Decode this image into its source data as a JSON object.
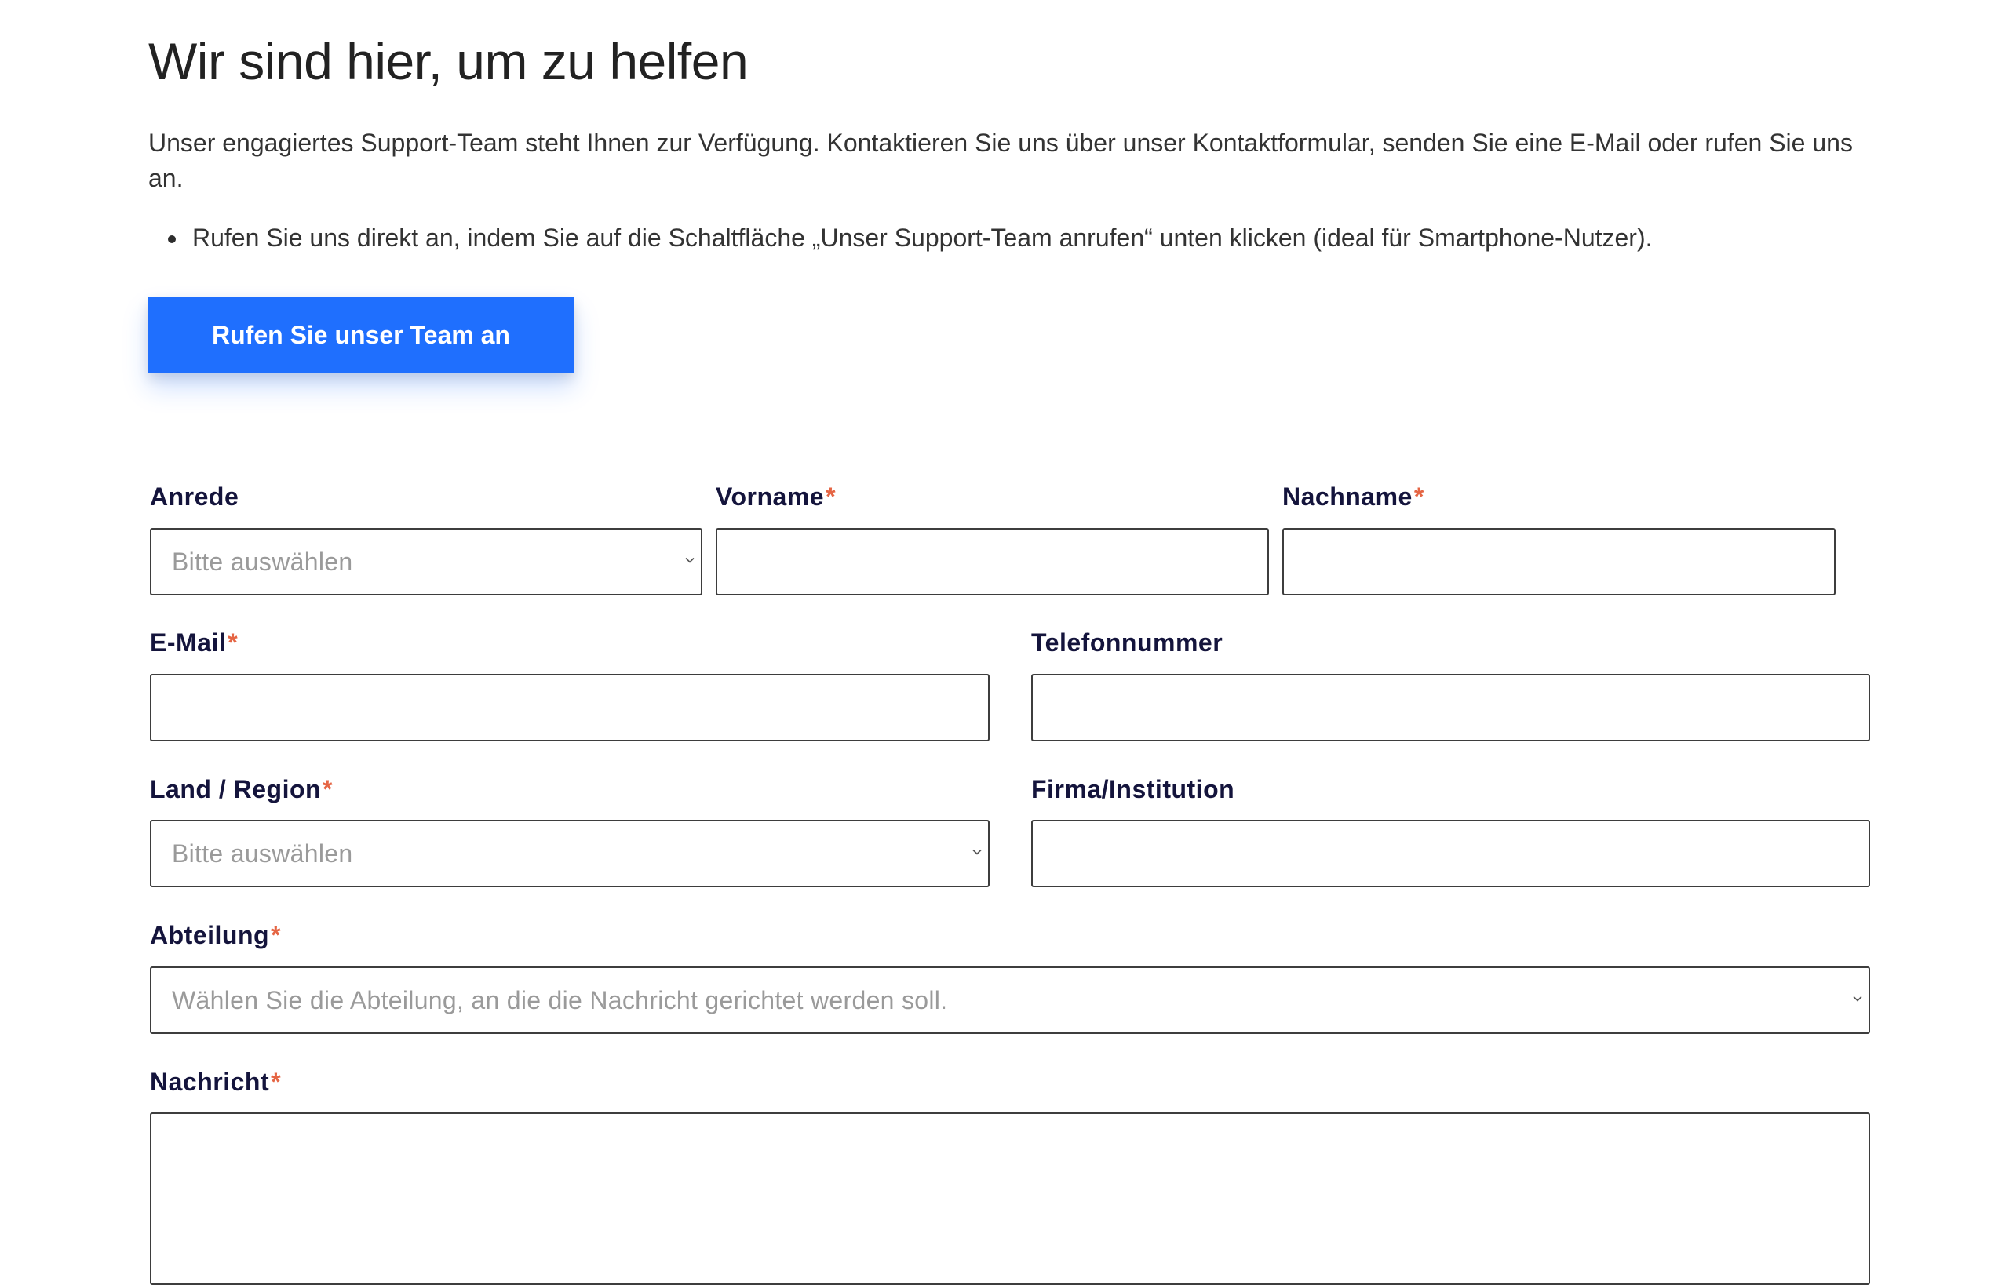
{
  "header": {
    "title": "Wir sind hier, um zu helfen",
    "intro": "Unser engagiertes Support-Team steht Ihnen zur Verfügung. Kontaktieren Sie uns über unser Kontaktformular, senden Sie eine E-Mail oder rufen Sie uns an.",
    "bullet": "Rufen Sie uns direkt an, indem Sie auf die Schaltfläche „Unser Support-Team anrufen“ unten klicken (ideal für Smartphone-Nutzer)."
  },
  "call_button": {
    "label": "Rufen Sie unser Team an"
  },
  "form": {
    "required_mark": "*",
    "salutation": {
      "label": "Anrede",
      "placeholder": "Bitte auswählen"
    },
    "first_name": {
      "label": "Vorname",
      "value": ""
    },
    "last_name": {
      "label": "Nachname",
      "value": ""
    },
    "email": {
      "label": "E-Mail",
      "value": ""
    },
    "phone": {
      "label": "Telefonnummer",
      "value": ""
    },
    "country": {
      "label": "Land / Region",
      "placeholder": "Bitte auswählen"
    },
    "company": {
      "label": "Firma/Institution",
      "value": ""
    },
    "department": {
      "label": "Abteilung",
      "placeholder": "Wählen Sie die Abteilung, an die die Nachricht gerichtet werden soll."
    },
    "message": {
      "label": "Nachricht",
      "value": ""
    }
  },
  "colors": {
    "primary_button": "#1f6ffe",
    "required_asterisk": "#e56544",
    "label_text": "#14143c",
    "field_border": "#3d3d3d",
    "placeholder_text": "#9a9a9a"
  },
  "icons": {
    "select_arrow": "chevron-down-icon"
  }
}
